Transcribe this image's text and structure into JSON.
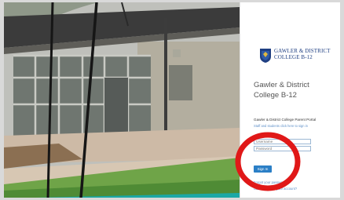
{
  "school": {
    "logo_line1": "GAWLER & DISTRICT",
    "logo_line2": "COLLEGE B-12",
    "title": "Gawler & District College B-12"
  },
  "login": {
    "portal_title": "Gawler & District College Parent Portal",
    "portal_subtitle": "Staff and students click here to sign in",
    "username_placeholder": "Username",
    "password_placeholder": "Password",
    "signin_label": "Sign In",
    "link_reset": "Forgot your password?",
    "link_help": "Cannot access your account?"
  },
  "colors": {
    "brand": "#1f3f82",
    "button": "#2b7fc6",
    "link": "#5e8fc8",
    "highlight_circle": "#e01818"
  }
}
